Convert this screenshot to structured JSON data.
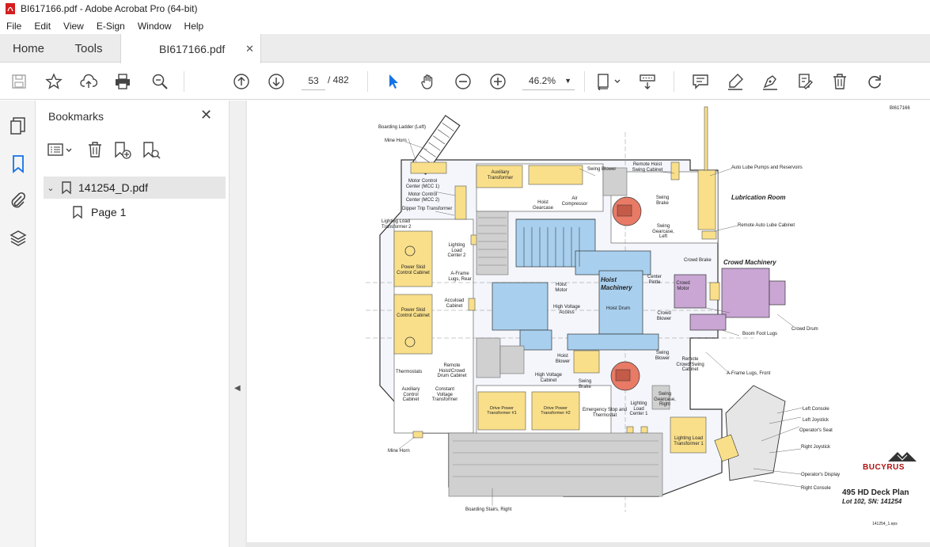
{
  "window": {
    "title": "BI617166.pdf - Adobe Acrobat Pro (64-bit)"
  },
  "menu": [
    "File",
    "Edit",
    "View",
    "E-Sign",
    "Window",
    "Help"
  ],
  "tabs": {
    "home": "Home",
    "tools": "Tools",
    "document": "BI617166.pdf"
  },
  "toolbar": {
    "current_page": "53",
    "total_pages": "/ 482",
    "zoom": "46.2%"
  },
  "bookmarks": {
    "title": "Bookmarks",
    "items": [
      {
        "label": "141254_D.pdf",
        "children": [
          {
            "label": "Page 1"
          }
        ]
      }
    ]
  },
  "drawing": {
    "doc_id": "BI617166",
    "brand": "BUCYRUS",
    "title": "495 HD Deck Plan",
    "subtitle": "Lot 102, SN: 141254",
    "footer_code": "141254_1.eps",
    "rooms": {
      "lubrication": "Lubrication Room",
      "crowd": "Crowd Machinery",
      "hoist": "Hoist Machinery"
    },
    "labels": {
      "boarding_ladder": "Boarding Ladder (Left)",
      "mine_horn_top": "Mine Horn",
      "mcc1": "Motor Control Center (MCC 1)",
      "mcc2": "Motor Control Center (MCC 2)",
      "dipper_trip": "Dipper Trip Transformer",
      "lighting_load_2": "Lighting Load Transformer 2",
      "power_skid_1": "Power Skid Control Cabinet",
      "power_skid_2": "Power Skid Control Cabinet",
      "thermostats": "Thermostats",
      "aux_control": "Auxiliary Control Cabinet",
      "constant_voltage": "Constant Voltage Transformer",
      "mine_horn_bottom": "Mine Horn",
      "aux_transformer": "Auxiliary Transformer",
      "lighting_load_center_2": "Lighting Load Center 2",
      "aframe_rear": "A-Frame Lugs, Rear",
      "accuload": "Accuload Cabinet",
      "remote_hoist_crowd": "Remote Hoist/Crowd Drum Cabinet",
      "drive_power_1": "Drive Power Transformer #1",
      "drive_power_2": "Drive Power Transformer #2",
      "emergency_stop": "Emergency Stop and Thermostat",
      "lighting_load_center_1": "Lighting Load Center 1",
      "swing_blower_top": "Swing Blower",
      "remote_hoist_swing": "Remote Hoist Swing Cabinet",
      "air_compressor": "Air Compressor",
      "hoist_gearcase": "Hoist Gearcase",
      "swing_brake_top": "Swing Brake",
      "swing_gearcase_left": "Swing Gearcase, Left",
      "hoist_motor": "Hoist Motor",
      "high_voltage_access": "High Voltage Access",
      "hoist_drum": "Hoist Drum",
      "center_pintle": "Center Pintle",
      "hoist_blower": "Hoist Blower",
      "high_voltage_cabinet": "High Voltage Cabinet",
      "swing_brake_bottom": "Swing Brake",
      "swing_blower_bottom": "Swing Blower",
      "swing_gearcase_right": "Swing Gearcase, Right",
      "remote_crowd_swing": "Remote Crowd/Swing Cabinet",
      "auto_lube_pumps": "Auto Lube Pumps and Reservoirs",
      "remote_auto_lube": "Remote Auto Lube Cabinet",
      "crowd_brake": "Crowd Brake",
      "crowd_motor": "Crowd Motor",
      "crowd_blower": "Crowd Blower",
      "crowd_drum": "Crowd Drum",
      "boom_foot_lugs": "Boom Foot Lugs",
      "aframe_front": "A-Frame Lugs, Front",
      "left_console": "Left Console",
      "left_joystick": "Left Joystick",
      "operators_seat": "Operator's Seat",
      "right_joystick": "Right Joystick",
      "lighting_load_1": "Lighting Load Transformer 1",
      "operators_display": "Operator's Display",
      "right_console": "Right Console",
      "boarding_stairs": "Boarding Stairs, Right"
    }
  }
}
